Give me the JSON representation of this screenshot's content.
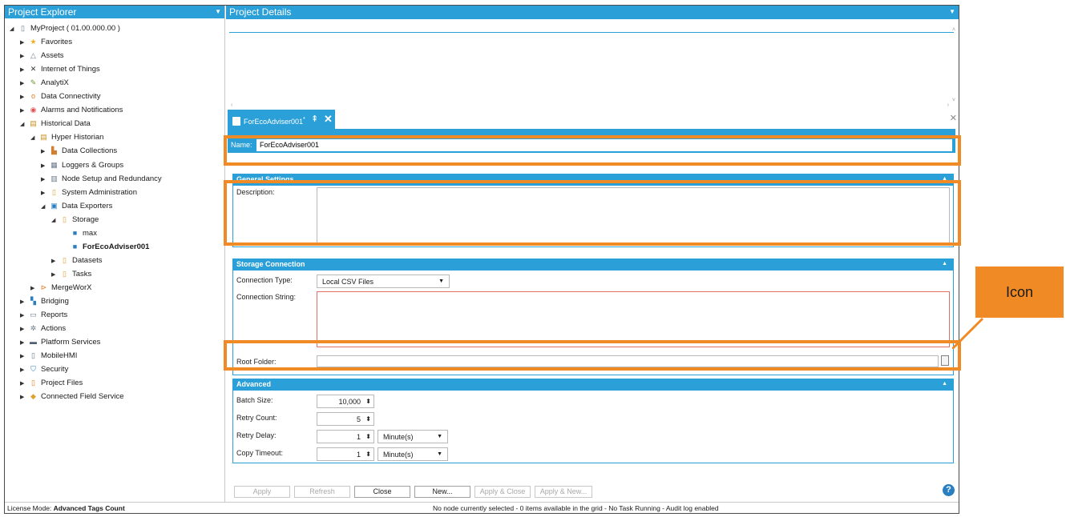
{
  "explorer": {
    "title": "Project Explorer",
    "items": [
      {
        "label": "MyProject ( 01.00.000.00 )",
        "icon": "project-icon",
        "arrow": "◢"
      },
      {
        "label": "Favorites",
        "icon": "star-icon",
        "arrow": "▶"
      },
      {
        "label": "Assets",
        "icon": "assets-icon",
        "arrow": "▶"
      },
      {
        "label": "Internet of Things",
        "icon": "iot-icon",
        "arrow": "▶"
      },
      {
        "label": "AnalytiX",
        "icon": "analytix-icon",
        "arrow": "▶"
      },
      {
        "label": "Data Connectivity",
        "icon": "data-connectivity-icon",
        "arrow": "▶"
      },
      {
        "label": "Alarms and Notifications",
        "icon": "alarm-icon",
        "arrow": "▶"
      },
      {
        "label": "Historical Data",
        "icon": "historical-data-icon",
        "arrow": "◢"
      },
      {
        "label": "Hyper Historian",
        "icon": "hyper-historian-icon",
        "arrow": "◢"
      },
      {
        "label": "Data Collections",
        "icon": "data-collections-icon",
        "arrow": "▶"
      },
      {
        "label": "Loggers & Groups",
        "icon": "loggers-icon",
        "arrow": "▶"
      },
      {
        "label": "Node Setup and Redundancy",
        "icon": "node-setup-icon",
        "arrow": "▶"
      },
      {
        "label": "System Administration",
        "icon": "folder-icon",
        "arrow": "▶"
      },
      {
        "label": "Data Exporters",
        "icon": "data-exporters-icon",
        "arrow": "◢"
      },
      {
        "label": "Storage",
        "icon": "folder-icon",
        "arrow": "◢"
      },
      {
        "label": "max",
        "icon": "storage-item-icon",
        "arrow": ""
      },
      {
        "label": "ForEcoAdviser001",
        "icon": "storage-item-icon",
        "arrow": ""
      },
      {
        "label": "Datasets",
        "icon": "folder-icon",
        "arrow": "▶"
      },
      {
        "label": "Tasks",
        "icon": "folder-icon",
        "arrow": "▶"
      },
      {
        "label": "MergeWorX",
        "icon": "mergeworx-icon",
        "arrow": "▶"
      },
      {
        "label": "Bridging",
        "icon": "bridging-icon",
        "arrow": "▶"
      },
      {
        "label": "Reports",
        "icon": "reports-icon",
        "arrow": "▶"
      },
      {
        "label": "Actions",
        "icon": "actions-icon",
        "arrow": "▶"
      },
      {
        "label": "Platform Services",
        "icon": "platform-services-icon",
        "arrow": "▶"
      },
      {
        "label": "MobileHMI",
        "icon": "mobile-icon",
        "arrow": "▶"
      },
      {
        "label": "Security",
        "icon": "security-icon",
        "arrow": "▶"
      },
      {
        "label": "Project Files",
        "icon": "project-files-icon",
        "arrow": "▶"
      },
      {
        "label": "Connected Field Service",
        "icon": "field-service-icon",
        "arrow": "▶"
      }
    ]
  },
  "details": {
    "title": "Project Details"
  },
  "doc_tab": {
    "label": "ForEcoAdviser001",
    "modified_marker": "*"
  },
  "form": {
    "name_label": "Name:",
    "name_value": "ForEcoAdviser001",
    "general": {
      "title": "General Settings",
      "description_label": "Description:"
    },
    "storage": {
      "title": "Storage Connection",
      "connection_type_label": "Connection Type:",
      "connection_type_value": "Local CSV Files",
      "connection_string_label": "Connection String:",
      "root_folder_label": "Root Folder:"
    },
    "advanced": {
      "title": "Advanced",
      "batch_size_label": "Batch Size:",
      "batch_size_value": "10,000",
      "retry_count_label": "Retry Count:",
      "retry_count_value": "5",
      "retry_delay_label": "Retry Delay:",
      "retry_delay_value": "1",
      "retry_delay_unit": "Minute(s)",
      "copy_timeout_label": "Copy Timeout:",
      "copy_timeout_value": "1",
      "copy_timeout_unit": "Minute(s)"
    }
  },
  "buttons": {
    "apply": "Apply",
    "refresh": "Refresh",
    "close": "Close",
    "new": "New...",
    "apply_close": "Apply & Close",
    "apply_new": "Apply & New...",
    "help": "?"
  },
  "status": {
    "license_prefix": "License Mode:",
    "license_value": "Advanced Tags Count",
    "message": "No node currently selected - 0 items available in the grid - No Task Running - Audit log enabled"
  },
  "annotation": {
    "callout_label": "Icon",
    "highlight_color": "#f08a24"
  },
  "theme": {
    "accent": "#2a9fd8"
  }
}
